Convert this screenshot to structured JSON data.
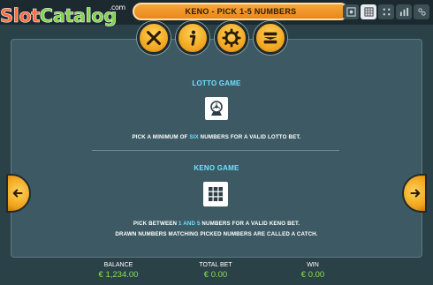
{
  "header": {
    "title": "KENO - PICK 1-5 NUMBERS",
    "logo_main_1": "Slot",
    "logo_main_2": "Catalog",
    "logo_suffix": ".com"
  },
  "mini_icons": [
    "help-icon",
    "grid-icon",
    "dice-icon",
    "bars-icon",
    "settings-icon"
  ],
  "buttons": [
    "close-icon",
    "info-icon",
    "gear-icon",
    "menu-icon"
  ],
  "lotto": {
    "title": "LOTTO GAME",
    "desc_before": "PICK A MINIMUM OF ",
    "desc_highlight": "SIX",
    "desc_after": " NUMBERS FOR A VALID LOTTO BET."
  },
  "keno": {
    "title": "KENO GAME",
    "line1_before": "PICK BETWEEN ",
    "line1_hl1": "1",
    "line1_mid": " AND ",
    "line1_hl2": "5",
    "line1_after": " NUMBERS FOR A VALID KENO BET.",
    "line2": "DRAWN NUMBERS MATCHING PICKED NUMBERS ARE CALLED A CATCH."
  },
  "footer": {
    "balance_label": "BALANCE",
    "balance_value": "€ 1,234.00",
    "total_bet_label": "TOTAL BET",
    "total_bet_value": "€ 0.00",
    "win_label": "WIN",
    "win_value": "€ 0.00"
  },
  "colors": {
    "accent": "#6fe0ff",
    "orange": "#f0a21a",
    "money": "#8fe05a",
    "panel": "#3d5a64"
  }
}
